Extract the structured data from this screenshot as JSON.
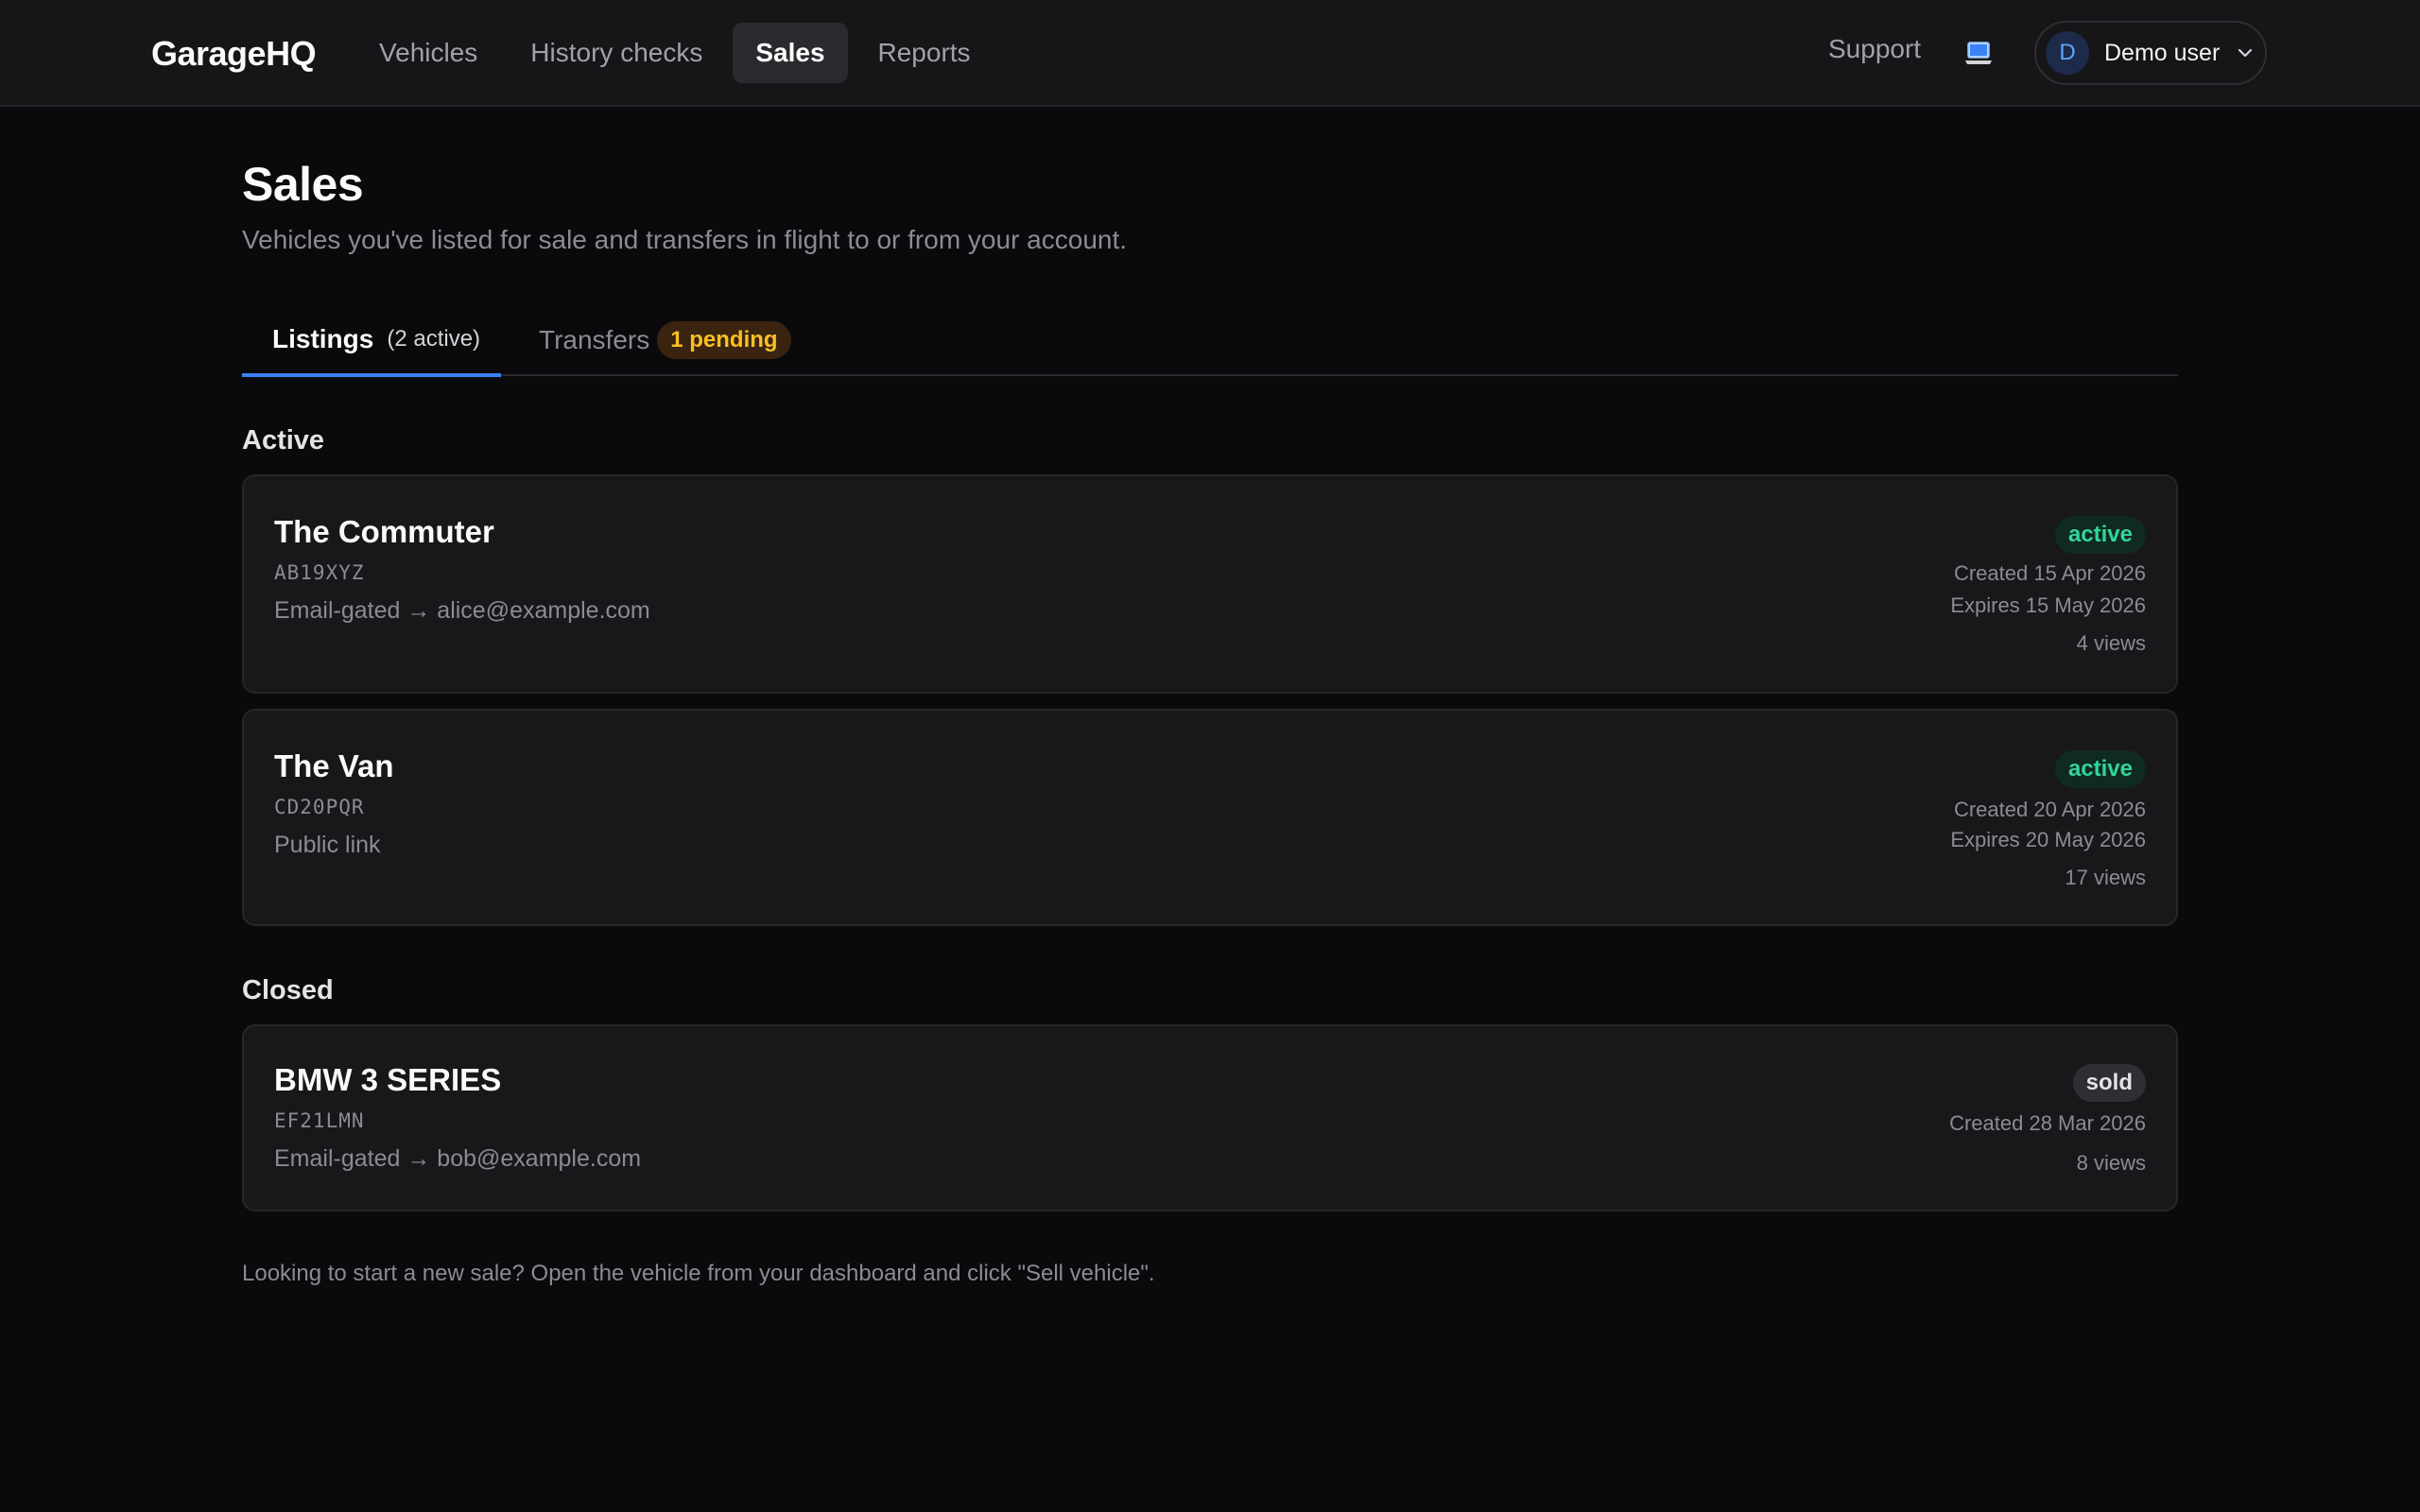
{
  "app": {
    "brand": "GarageHQ"
  },
  "nav": {
    "items": [
      {
        "label": "Vehicles"
      },
      {
        "label": "History checks"
      },
      {
        "label": "Sales"
      },
      {
        "label": "Reports"
      }
    ],
    "active": "Sales"
  },
  "header": {
    "support_label": "Support",
    "laptop_icon": "laptop-icon",
    "user_initial": "D",
    "user_name": "Demo user"
  },
  "page": {
    "title": "Sales",
    "subtitle": "Vehicles you've listed for sale and transfers in flight to or from your account."
  },
  "tabs": {
    "listings_label": "Listings",
    "listings_count": "(2 active)",
    "transfers_label": "Transfers",
    "transfers_badge": "1 pending"
  },
  "sections": {
    "active_heading": "Active",
    "closed_heading": "Closed"
  },
  "listings": {
    "active": [
      {
        "name": "The Commuter",
        "registration": "AB19XYZ",
        "access": "Email-gated → alice@example.com",
        "status": "active",
        "created": "Created 15 Apr 2026",
        "expires": "Expires 15 May 2026",
        "views": "4 views"
      },
      {
        "name": "The Van",
        "registration": "CD20PQR",
        "access": "Public link",
        "status": "active",
        "created": "Created 20 Apr 2026",
        "expires": "Expires 20 May 2026",
        "views": "17 views"
      }
    ],
    "closed": [
      {
        "name": "BMW 3 SERIES",
        "registration": "EF21LMN",
        "access": "Email-gated → bob@example.com",
        "status": "sold",
        "created": "Created 28 Mar 2026",
        "views": "8 views"
      }
    ]
  },
  "colors": {
    "background": "#0a0a0c",
    "accent": "#3b82f6",
    "active_status": "#34d399",
    "pending_badge": "#fbbf24"
  },
  "footer": {
    "note": "Looking to start a new sale? Open the vehicle from your dashboard and click \"Sell vehicle\"."
  }
}
